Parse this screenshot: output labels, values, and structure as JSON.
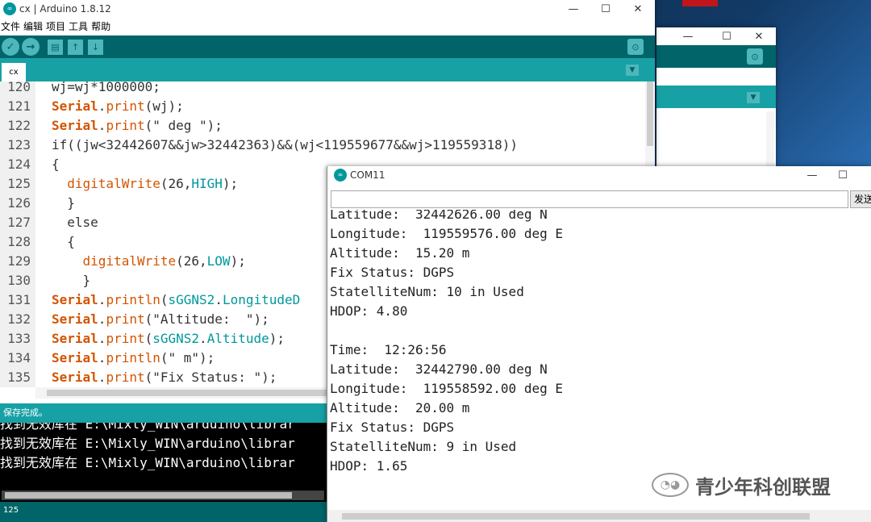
{
  "arduino": {
    "title": "cx | Arduino 1.8.12",
    "logo_icon": "arduino-logo-icon",
    "menus": [
      "文件",
      "编辑",
      "项目",
      "工具",
      "帮助"
    ],
    "toolbar": {
      "verify_icon": "checkmark-icon",
      "upload_icon": "arrow-right-icon",
      "new_icon": "new-file-icon",
      "open_icon": "arrow-up-icon",
      "save_icon": "arrow-down-icon",
      "serial_icon": "magnifier-icon"
    },
    "tab_label": "cx",
    "code_lines": [
      {
        "num": "120",
        "html": "wj=wj*1000000;"
      },
      {
        "num": "121",
        "html": "<span class=\"kw\">Serial</span>.<span class=\"fn\">print</span>(wj);"
      },
      {
        "num": "122",
        "html": "<span class=\"kw\">Serial</span>.<span class=\"fn\">print</span>(\" deg \");"
      },
      {
        "num": "123",
        "html": "if((jw&lt;32442607&amp;&amp;jw&gt;32442363)&amp;&amp;(wj&lt;119559677&amp;&amp;wj&gt;119559318))"
      },
      {
        "num": "124",
        "html": "{"
      },
      {
        "num": "125",
        "html": "  <span class=\"fn\">digitalWrite</span>(26,<span class=\"cn\">HIGH</span>);"
      },
      {
        "num": "126",
        "html": "  }"
      },
      {
        "num": "127",
        "html": "  else"
      },
      {
        "num": "128",
        "html": "  {"
      },
      {
        "num": "129",
        "html": "    <span class=\"fn\">digitalWrite</span>(26,<span class=\"cn\">LOW</span>);"
      },
      {
        "num": "130",
        "html": "    }"
      },
      {
        "num": "131",
        "html": "<span class=\"kw\">Serial</span>.<span class=\"fn\">println</span>(<span class=\"cn\">sGGNS2</span>.<span class=\"cn\">LongitudeD</span>"
      },
      {
        "num": "132",
        "html": "<span class=\"kw\">Serial</span>.<span class=\"fn\">print</span>(\"Altitude:  \");"
      },
      {
        "num": "133",
        "html": "<span class=\"kw\">Serial</span>.<span class=\"fn\">print</span>(<span class=\"cn\">sGGNS2</span>.<span class=\"cn\">Altitude</span>);"
      },
      {
        "num": "134",
        "html": "<span class=\"kw\">Serial</span>.<span class=\"fn\">println</span>(\" m\");"
      },
      {
        "num": "135",
        "html": "<span class=\"kw\">Serial</span>.<span class=\"fn\">print</span>(\"Fix Status: \");"
      }
    ],
    "status_text": "保存完成。",
    "console_lines": [
      "找到无效库在 E:\\Mixly_WIN\\arduino\\librar",
      "找到无效库在 E:\\Mixly_WIN\\arduino\\librar",
      "找到无效库在 E:\\Mixly_WIN\\arduino\\librar"
    ],
    "bottom_line": "125"
  },
  "serial_monitor": {
    "title": "COM11",
    "send_label": "发送",
    "output_lines": [
      "Latitude:  32442626.00 deg N",
      "Longitude:  119559576.00 deg E",
      "Altitude:  15.20 m",
      "Fix Status: DGPS",
      "StatelliteNum: 10 in Used",
      "HDOP: 4.80",
      "",
      "Time:  12:26:56",
      "Latitude:  32442790.00 deg N",
      "Longitude:  119558592.00 deg E",
      "Altitude:  20.00 m",
      "Fix Status: DGPS",
      "StatelliteNum: 9 in Used",
      "HDOP: 1.65"
    ]
  },
  "watermark": {
    "icon": "wechat-icon",
    "text": "青少年科创联盟"
  },
  "window_controls": {
    "minimize": "—",
    "maximize": "☐",
    "close": "✕"
  }
}
